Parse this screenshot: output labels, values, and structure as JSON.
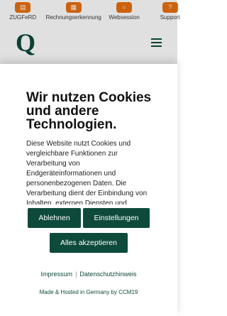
{
  "topbar": {
    "items": [
      {
        "label": "ZUGFeRD",
        "icon": "document-icon"
      },
      {
        "label": "Rechnungserkennung",
        "icon": "document-scan-icon"
      },
      {
        "label": "Websession",
        "icon": "chat-icon"
      },
      {
        "label": "Support",
        "icon": "support-icon"
      }
    ]
  },
  "header": {
    "logo_text": "Q"
  },
  "cookie_dialog": {
    "title": "Wir nutzen Cookies und andere Technologien.",
    "description": "Diese Website nutzt Cookies und vergleichbare Funktionen zur Verarbeitung von Endgeräteinformationen und personenbezogenen Daten. Die Verarbeitung dient der Einbindung von Inhalten, externen Diensten und",
    "decline_label": "Ablehnen",
    "settings_label": "Einstellungen",
    "accept_label": "Alles akzeptieren",
    "imprint_link": "Impressum",
    "separator": "|",
    "privacy_link": "Datenschutzhinweis",
    "footer": "Made & Hosted in Germany by CCM19"
  },
  "colors": {
    "brand_dark": "#0e4a3c",
    "accent_orange": "#e9700f"
  }
}
